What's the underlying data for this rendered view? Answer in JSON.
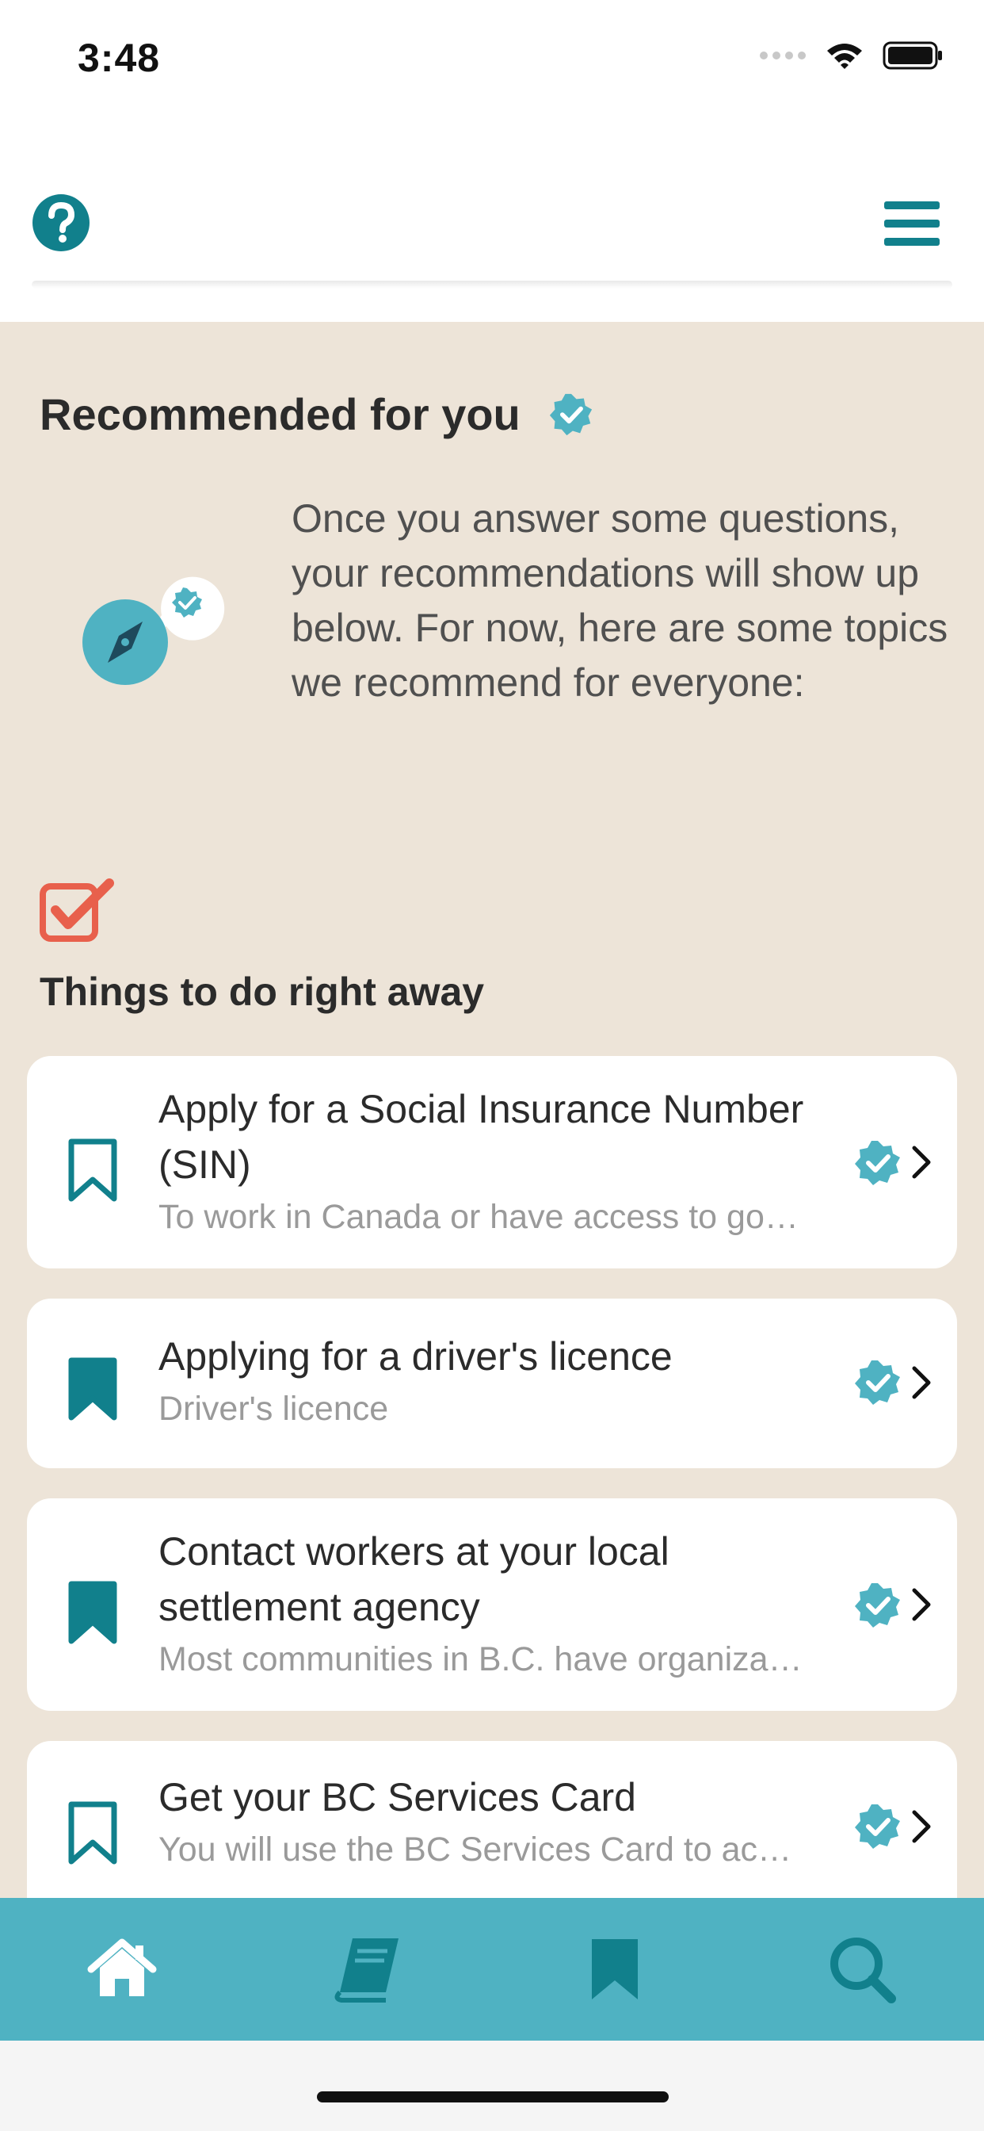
{
  "status_bar": {
    "time": "3:48"
  },
  "colors": {
    "teal": "#11808c",
    "light_teal": "#4fb2c2",
    "beige": "#ede4d8",
    "coral": "#e8604c"
  },
  "header": {
    "help_icon": "question-circle-icon",
    "menu_icon": "hamburger-menu-icon"
  },
  "recommended": {
    "title": "Recommended for you",
    "intro": "Once you answer some questions, your recommendations will show up below. For now, here are some topics we recommend for everyone:"
  },
  "section": {
    "title": "Things to do right away"
  },
  "cards": [
    {
      "title": "Apply for a Social Insurance Number (SIN)",
      "subtitle": "To work in Canada or have access to government programs and benefits",
      "bookmarked": false
    },
    {
      "title": "Applying for a driver's licence",
      "subtitle": "Driver's licence",
      "bookmarked": true
    },
    {
      "title": "Contact workers at your local settlement agency",
      "subtitle": "Most communities in B.C. have organizations that help newcomers",
      "bookmarked": true
    },
    {
      "title": "Get your BC Services Card",
      "subtitle": "You will use the BC Services Card to access health care",
      "bookmarked": false
    }
  ],
  "tabs": [
    {
      "name": "home",
      "icon": "home-icon"
    },
    {
      "name": "learn",
      "icon": "book-icon"
    },
    {
      "name": "bookmarks",
      "icon": "bookmark-icon"
    },
    {
      "name": "search",
      "icon": "search-icon"
    }
  ]
}
